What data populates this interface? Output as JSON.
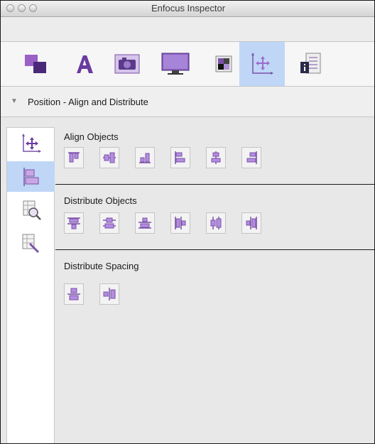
{
  "window": {
    "title": "Enfocus Inspector"
  },
  "toolbar": {
    "items": [
      {
        "name": "object-fill-icon"
      },
      {
        "name": "text-icon"
      },
      {
        "name": "image-icon"
      },
      {
        "name": "display-icon"
      },
      {
        "name": "color-separation-icon"
      },
      {
        "name": "position-icon",
        "active": true
      },
      {
        "name": "info-icon"
      }
    ]
  },
  "section": {
    "title": "Position - Align and Distribute"
  },
  "sidebar": {
    "items": [
      {
        "name": "move-icon"
      },
      {
        "name": "align-distribute-icon",
        "active": true
      },
      {
        "name": "zoom-icon"
      },
      {
        "name": "edit-icon"
      }
    ]
  },
  "groups": [
    {
      "label": "Align Objects",
      "buttons": [
        "align-top-icon",
        "align-vertical-center-icon",
        "align-bottom-icon",
        "align-left-icon",
        "align-horizontal-center-icon",
        "align-right-icon"
      ]
    },
    {
      "label": "Distribute Objects",
      "buttons": [
        "distribute-top-icon",
        "distribute-vertical-center-icon",
        "distribute-bottom-icon",
        "distribute-left-icon",
        "distribute-horizontal-center-icon",
        "distribute-right-icon"
      ]
    },
    {
      "label": "Distribute Spacing",
      "buttons": [
        "distribute-spacing-vertical-icon",
        "distribute-spacing-horizontal-icon"
      ]
    }
  ],
  "colors": {
    "accent": "#8b52b8",
    "accent_light": "#c9a7e4",
    "active_bg": "#bfd6f6"
  }
}
